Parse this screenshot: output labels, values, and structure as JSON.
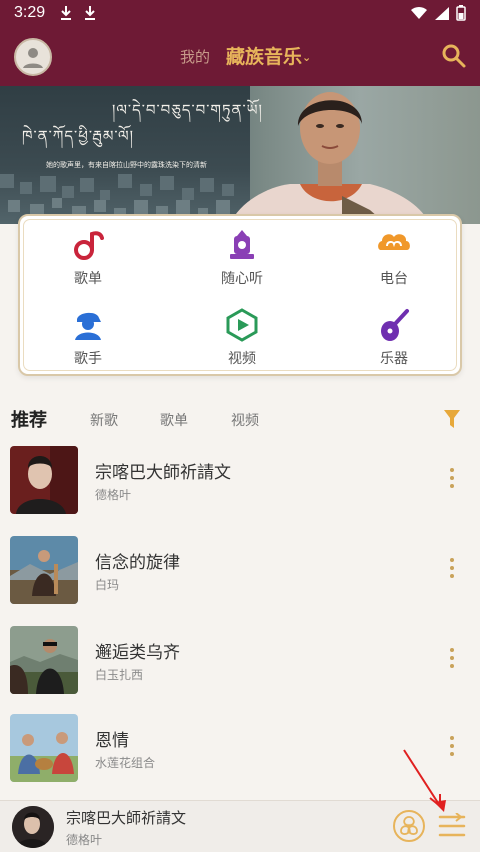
{
  "status": {
    "time": "3:29"
  },
  "header": {
    "tab_mine": "我的",
    "tab_main": "藏族音乐"
  },
  "banner": {
    "tibetan_line1": "།ལ་དེ་བ་བཅུད་བ་གཏུན་ཡོ།",
    "tibetan_line2": "ཁེ་ན་ཀོད་ཕྱི་རྦུམ་ལོ།",
    "subtitle": "她的歌声里，有来自喀拉山野中的露珠洗染下的清新"
  },
  "menu": {
    "items": [
      {
        "label": "歌单",
        "icon": "song-list-icon"
      },
      {
        "label": "随心听",
        "icon": "random-listen-icon"
      },
      {
        "label": "电台",
        "icon": "radio-icon"
      },
      {
        "label": "歌手",
        "icon": "singer-icon"
      },
      {
        "label": "视频",
        "icon": "video-icon"
      },
      {
        "label": "乐器",
        "icon": "instrument-icon"
      }
    ]
  },
  "tabs": [
    {
      "label": "推荐",
      "active": true
    },
    {
      "label": "新歌",
      "active": false
    },
    {
      "label": "歌单",
      "active": false
    },
    {
      "label": "视频",
      "active": false
    }
  ],
  "songs": [
    {
      "title": "宗喀巴大師祈請文",
      "artist": "德格叶"
    },
    {
      "title": "信念的旋律",
      "artist": "白玛"
    },
    {
      "title": "邂逅类乌齐",
      "artist": "白玉扎西"
    },
    {
      "title": "恩情",
      "artist": "水莲花组合"
    }
  ],
  "player": {
    "title": "宗喀巴大師祈請文",
    "artist": "德格叶"
  },
  "colors": {
    "brand": "#6e1a35",
    "accent": "#e7b45b",
    "more": "#c9a25a"
  }
}
